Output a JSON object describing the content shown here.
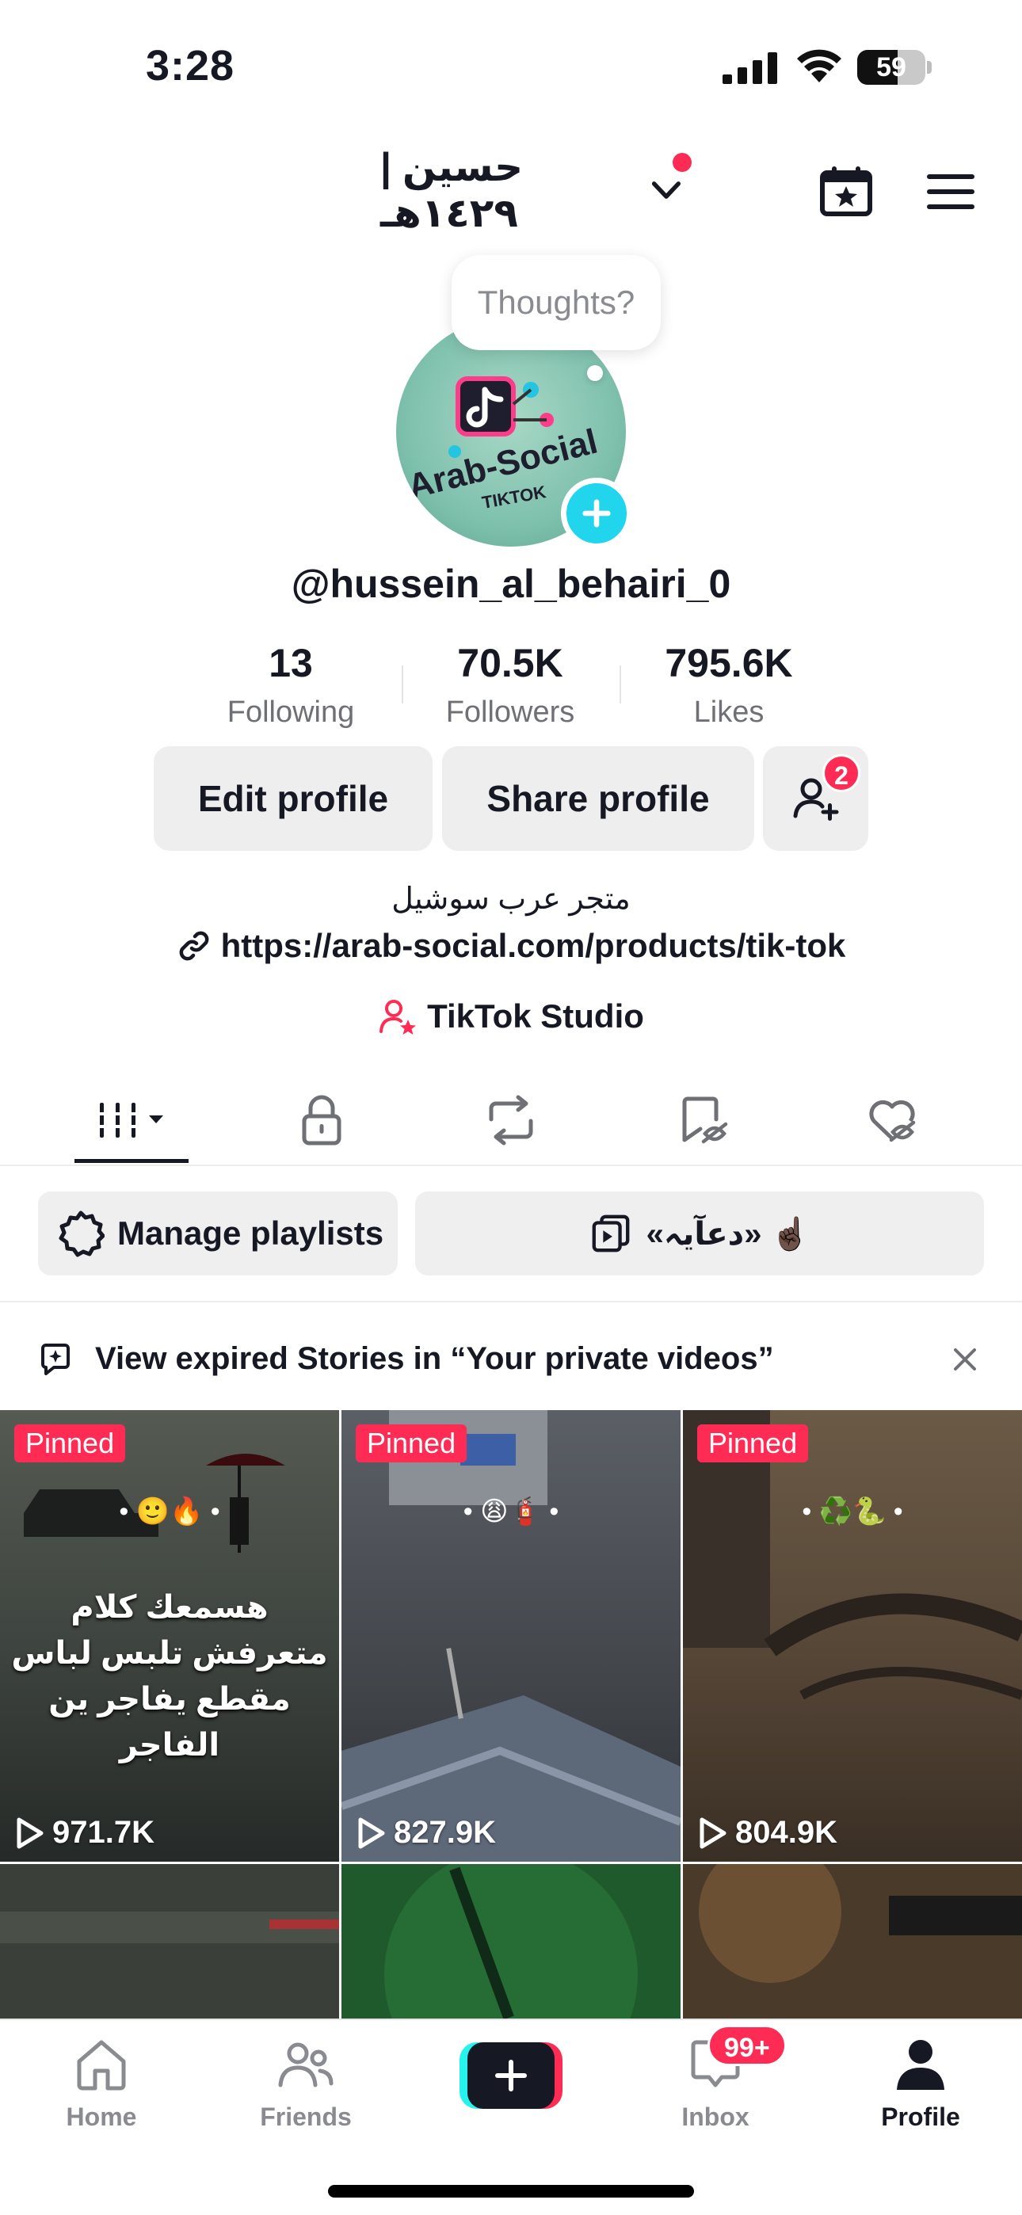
{
  "status_bar": {
    "time": "3:28",
    "battery_level": "59"
  },
  "header": {
    "account_name": "حسين | ١٤٢٩هـ"
  },
  "profile": {
    "thoughts_placeholder": "Thoughts?",
    "username": "@hussein_al_behairi_0",
    "stats": [
      {
        "value": "13",
        "label": "Following"
      },
      {
        "value": "70.5K",
        "label": "Followers"
      },
      {
        "value": "795.6K",
        "label": "Likes"
      }
    ],
    "buttons": {
      "edit": "Edit profile",
      "share": "Share profile",
      "friends_badge": "2"
    },
    "bio": "متجر عرب سوشيل",
    "link": "https://arab-social.com/products/tik-tok",
    "studio": "TikTok Studio"
  },
  "playlists": {
    "manage_label": "Manage playlists",
    "playlist_name": "«دعآيہ» ☝🏿"
  },
  "stories_banner": {
    "text": "View expired Stories in “Your private videos”"
  },
  "videos": [
    {
      "pinned": "Pinned",
      "views": "971.7K",
      "caption": "هسمعك كلام متعرفش تلبس لباس مقطع يفاجر ين الفاجر",
      "emoji": "• 🙂🔥 •"
    },
    {
      "pinned": "Pinned",
      "views": "827.9K",
      "caption": "",
      "emoji": "• 😩🧯 •"
    },
    {
      "pinned": "Pinned",
      "views": "804.9K",
      "caption": "",
      "emoji": "• ♻️🐍 •"
    }
  ],
  "bottom_nav": {
    "home": "Home",
    "friends": "Friends",
    "inbox": "Inbox",
    "inbox_badge": "99+",
    "profile": "Profile"
  },
  "colors": {
    "accent": "#fe2c55",
    "teal": "#20d5ec",
    "text": "#161823",
    "muted": "#8a8b91"
  }
}
